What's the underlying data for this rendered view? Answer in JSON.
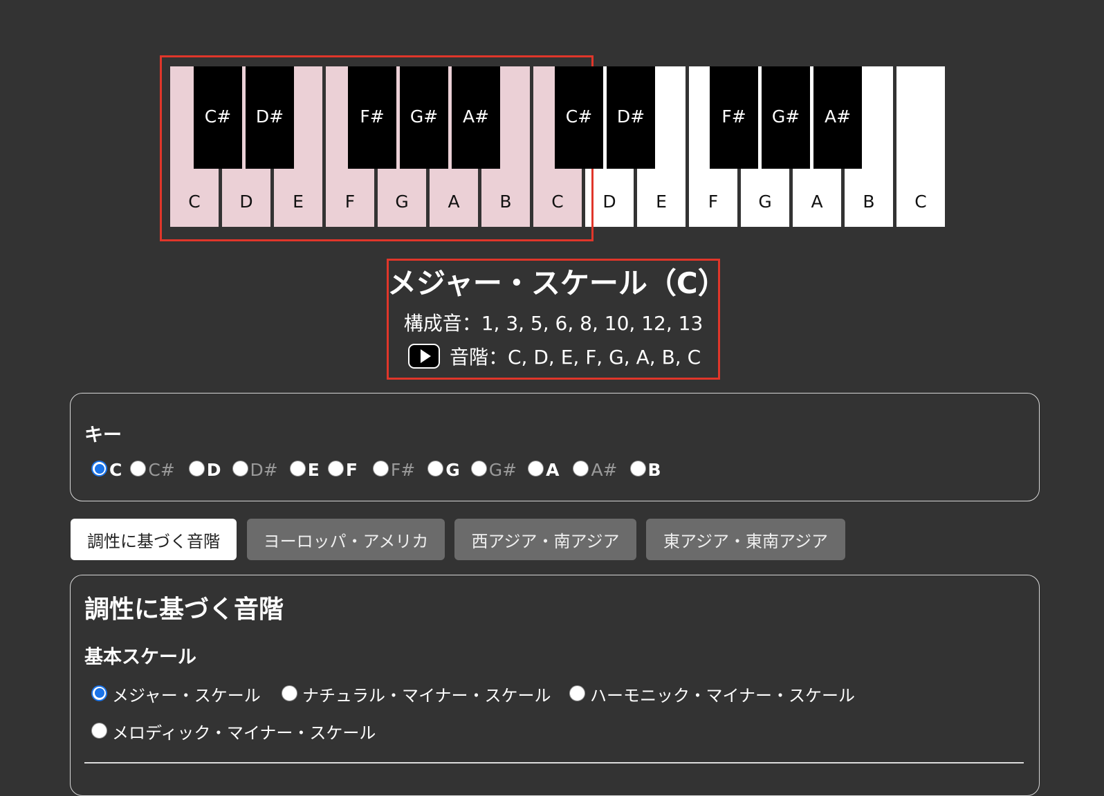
{
  "piano": {
    "white_keys": [
      {
        "label": "C",
        "highlighted": true
      },
      {
        "label": "D",
        "highlighted": true
      },
      {
        "label": "E",
        "highlighted": true
      },
      {
        "label": "F",
        "highlighted": true
      },
      {
        "label": "G",
        "highlighted": true
      },
      {
        "label": "A",
        "highlighted": true
      },
      {
        "label": "B",
        "highlighted": true
      },
      {
        "label": "C",
        "highlighted": true
      },
      {
        "label": "D",
        "highlighted": false
      },
      {
        "label": "E",
        "highlighted": false
      },
      {
        "label": "F",
        "highlighted": false
      },
      {
        "label": "G",
        "highlighted": false
      },
      {
        "label": "A",
        "highlighted": false
      },
      {
        "label": "B",
        "highlighted": false
      },
      {
        "label": "C",
        "highlighted": false
      }
    ],
    "black_keys": [
      {
        "label": "C#"
      },
      {
        "label": "D#"
      },
      {
        "label": "F#"
      },
      {
        "label": "G#"
      },
      {
        "label": "A#"
      },
      {
        "label": "C#"
      },
      {
        "label": "D#"
      },
      {
        "label": "F#"
      },
      {
        "label": "G#"
      },
      {
        "label": "A#"
      }
    ],
    "highlight_color": "#ebd0d6",
    "annotation_color": "#e0362a"
  },
  "scale_info": {
    "title": "メジャー・スケール（C）",
    "members": "構成音：1, 3, 5, 6, 8, 10, 12, 13",
    "notes": "音階：C, D, E, F, G, A, B, C",
    "play_icon": "play-icon"
  },
  "key_selector": {
    "heading": "キー",
    "options": [
      {
        "label": "C",
        "selected": true,
        "sharp": false
      },
      {
        "label": "C#",
        "selected": false,
        "sharp": true
      },
      {
        "label": "D",
        "selected": false,
        "sharp": false
      },
      {
        "label": "D#",
        "selected": false,
        "sharp": true
      },
      {
        "label": "E",
        "selected": false,
        "sharp": false
      },
      {
        "label": "F",
        "selected": false,
        "sharp": false
      },
      {
        "label": "F#",
        "selected": false,
        "sharp": true
      },
      {
        "label": "G",
        "selected": false,
        "sharp": false
      },
      {
        "label": "G#",
        "selected": false,
        "sharp": true
      },
      {
        "label": "A",
        "selected": false,
        "sharp": false
      },
      {
        "label": "A#",
        "selected": false,
        "sharp": true
      },
      {
        "label": "B",
        "selected": false,
        "sharp": false
      }
    ]
  },
  "tabs": [
    {
      "label": "調性に基づく音階",
      "active": true
    },
    {
      "label": "ヨーロッパ・アメリカ",
      "active": false
    },
    {
      "label": "西アジア・南アジア",
      "active": false
    },
    {
      "label": "東アジア・東南アジア",
      "active": false
    }
  ],
  "scale_panel": {
    "title": "調性に基づく音階",
    "basic_heading": "基本スケール",
    "options": [
      {
        "label": "メジャー・スケール",
        "selected": true
      },
      {
        "label": "ナチュラル・マイナー・スケール",
        "selected": false
      },
      {
        "label": "ハーモニック・マイナー・スケール",
        "selected": false
      },
      {
        "label": "メロディック・マイナー・スケール",
        "selected": false
      }
    ]
  },
  "colors": {
    "background": "#333333",
    "radio_accent": "#1a73e8",
    "tab_inactive": "#6b6b6b"
  }
}
